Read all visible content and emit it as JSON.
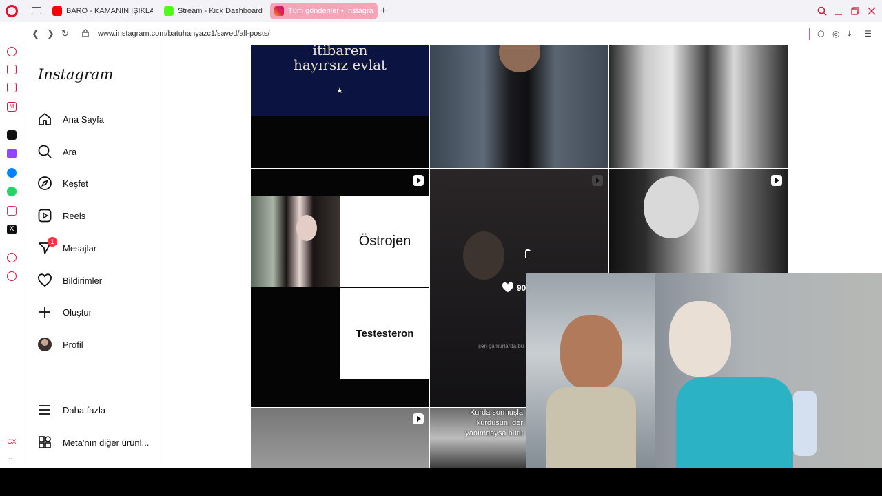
{
  "browser": {
    "tabs": [
      {
        "label": "BARO - KAMANIN IŞIKLAF",
        "color": "#ff0000"
      },
      {
        "label": "Stream - Kick Dashboard",
        "color": "#53fc18"
      },
      {
        "label": "Tüm gönderiler • Instagra",
        "color": "#e1306c"
      }
    ],
    "new_tab": "+",
    "url": "www.instagram.com/batuhanyazc1/saved/all-posts/"
  },
  "instagram": {
    "logo": "Instagram",
    "nav": [
      {
        "label": "Ana Sayfa",
        "icon": "home-icon"
      },
      {
        "label": "Ara",
        "icon": "search-icon"
      },
      {
        "label": "Keşfet",
        "icon": "compass-icon"
      },
      {
        "label": "Reels",
        "icon": "reels-icon"
      },
      {
        "label": "Mesajlar",
        "icon": "messenger-icon",
        "badge": "1"
      },
      {
        "label": "Bildirimler",
        "icon": "heart-icon"
      },
      {
        "label": "Oluştur",
        "icon": "plus-icon"
      },
      {
        "label": "Profil",
        "icon": "avatar"
      }
    ],
    "more": "Daha fazla",
    "meta": "Meta'nın diğer ürünl..."
  },
  "grid": {
    "post1_line1": "itibaren",
    "post1_line2": "hayırsız evlat",
    "post4_top": "Östrojen",
    "post4_bottom": "Testesteron",
    "post5_likes": "90",
    "post5_caption": "sen çamurlarda bu",
    "post8_caption_1": "Kurda sormuşla",
    "post8_caption_2": "kurdusun, der",
    "post8_caption_3": "yanımdaysa bütü"
  }
}
